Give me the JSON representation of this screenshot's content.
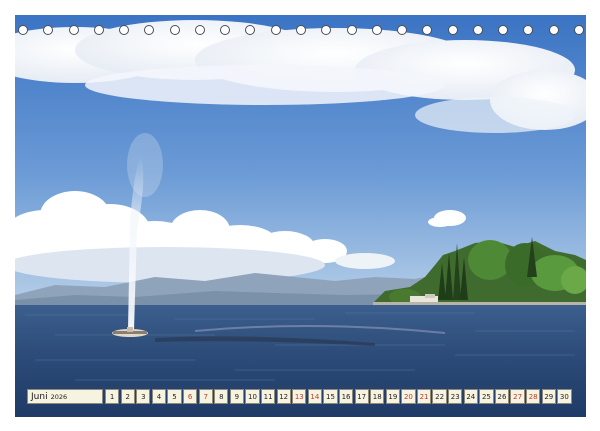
{
  "calendar": {
    "month": "Juni",
    "year": "2026",
    "days": [
      {
        "d": "1",
        "w": false
      },
      {
        "d": "2",
        "w": false
      },
      {
        "d": "3",
        "w": false
      },
      {
        "d": "4",
        "w": false
      },
      {
        "d": "5",
        "w": false
      },
      {
        "d": "6",
        "w": true
      },
      {
        "d": "7",
        "w": true
      },
      {
        "d": "8",
        "w": false
      },
      {
        "d": "9",
        "w": false
      },
      {
        "d": "10",
        "w": false
      },
      {
        "d": "11",
        "w": false
      },
      {
        "d": "12",
        "w": false
      },
      {
        "d": "13",
        "w": true
      },
      {
        "d": "14",
        "w": true
      },
      {
        "d": "15",
        "w": false
      },
      {
        "d": "16",
        "w": false
      },
      {
        "d": "17",
        "w": false
      },
      {
        "d": "18",
        "w": false
      },
      {
        "d": "19",
        "w": false
      },
      {
        "d": "20",
        "w": true
      },
      {
        "d": "21",
        "w": true
      },
      {
        "d": "22",
        "w": false
      },
      {
        "d": "23",
        "w": false
      },
      {
        "d": "24",
        "w": false
      },
      {
        "d": "25",
        "w": false
      },
      {
        "d": "26",
        "w": false
      },
      {
        "d": "27",
        "w": true
      },
      {
        "d": "28",
        "w": true
      },
      {
        "d": "29",
        "w": false
      },
      {
        "d": "30",
        "w": false
      }
    ]
  },
  "binding": {
    "hole_count": 23
  },
  "colors": {
    "sky_top": "#3f78c6",
    "sky_bottom": "#a9c7e6",
    "water": "#2c4a78",
    "weekend_text": "#c0392b"
  }
}
